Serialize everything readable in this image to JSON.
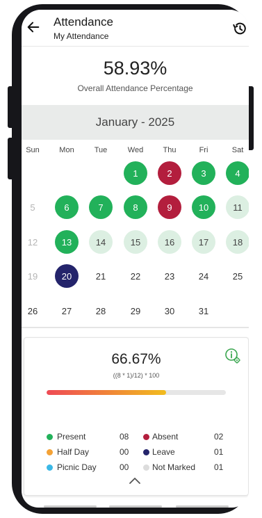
{
  "header": {
    "title": "Attendance",
    "subtitle": "My Attendance"
  },
  "overall": {
    "percentage": "58.93%",
    "label": "Overall Attendance Percentage"
  },
  "calendar": {
    "month": "January - 2025",
    "weekdays": [
      "Sun",
      "Mon",
      "Tue",
      "Wed",
      "Thu",
      "Fri",
      "Sat"
    ],
    "weeks": [
      [
        null,
        null,
        null,
        {
          "d": "1",
          "s": "present"
        },
        {
          "d": "2",
          "s": "absent"
        },
        {
          "d": "3",
          "s": "present"
        },
        {
          "d": "4",
          "s": "present"
        }
      ],
      [
        {
          "d": "5",
          "s": "faint"
        },
        {
          "d": "6",
          "s": "present"
        },
        {
          "d": "7",
          "s": "present"
        },
        {
          "d": "8",
          "s": "present"
        },
        {
          "d": "9",
          "s": "absent"
        },
        {
          "d": "10",
          "s": "present"
        },
        {
          "d": "11",
          "s": "notmarked"
        }
      ],
      [
        {
          "d": "12",
          "s": "faint"
        },
        {
          "d": "13",
          "s": "present"
        },
        {
          "d": "14",
          "s": "notmarked"
        },
        {
          "d": "15",
          "s": "notmarked"
        },
        {
          "d": "16",
          "s": "notmarked"
        },
        {
          "d": "17",
          "s": "notmarked"
        },
        {
          "d": "18",
          "s": "notmarked"
        }
      ],
      [
        {
          "d": "19",
          "s": "faint"
        },
        {
          "d": "20",
          "s": "leave"
        },
        {
          "d": "21",
          "s": "plain"
        },
        {
          "d": "22",
          "s": "plain"
        },
        {
          "d": "23",
          "s": "plain"
        },
        {
          "d": "24",
          "s": "plain"
        },
        {
          "d": "25",
          "s": "plain"
        }
      ],
      [
        {
          "d": "26",
          "s": "plain"
        },
        {
          "d": "27",
          "s": "plain"
        },
        {
          "d": "28",
          "s": "plain"
        },
        {
          "d": "29",
          "s": "plain"
        },
        {
          "d": "30",
          "s": "plain"
        },
        {
          "d": "31",
          "s": "plain"
        },
        null
      ]
    ]
  },
  "summary": {
    "percentage": "66.67%",
    "formula": "((8 * 1)/12) * 100",
    "progress_fraction": 0.6667,
    "legend": [
      {
        "name": "legend-present",
        "label": "Present",
        "count": "08",
        "color": "#22b15a"
      },
      {
        "name": "legend-absent",
        "label": "Absent",
        "count": "02",
        "color": "#b31e3d"
      },
      {
        "name": "legend-half-day",
        "label": "Half Day",
        "count": "00",
        "color": "#f4a236"
      },
      {
        "name": "legend-leave",
        "label": "Leave",
        "count": "01",
        "color": "#24246b"
      },
      {
        "name": "legend-picnic-day",
        "label": "Picnic Day",
        "count": "00",
        "color": "#3bb8e6"
      },
      {
        "name": "legend-not-marked",
        "label": "Not Marked",
        "count": "01",
        "color": "#dcdcdc"
      }
    ]
  },
  "icons": {
    "back": "arrow-left-icon",
    "history": "history-icon",
    "info": "info-settings-icon",
    "collapse": "chevron-up-icon"
  }
}
